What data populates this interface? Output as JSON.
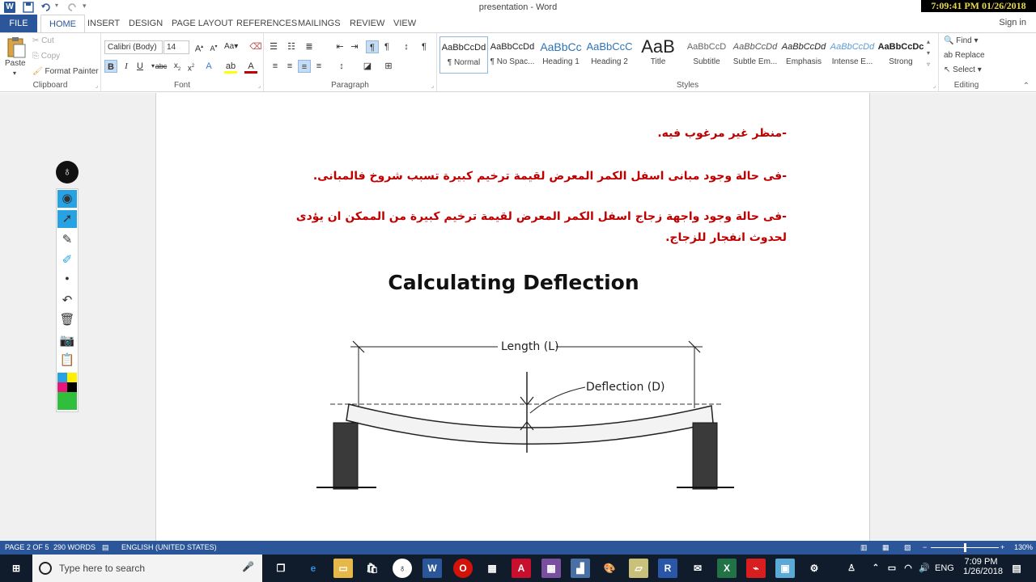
{
  "title_bar": {
    "title": "presentation - Word",
    "clock": "7:09:41 PM 01/26/2018",
    "word_logo": "W"
  },
  "tabs": [
    "FILE",
    "HOME",
    "INSERT",
    "DESIGN",
    "PAGE LAYOUT",
    "REFERENCES",
    "MAILINGS",
    "REVIEW",
    "VIEW"
  ],
  "active_tab": "HOME",
  "sign_in": "Sign in",
  "clipboard": {
    "paste": "Paste",
    "cut": "Cut",
    "copy": "Copy",
    "format_painter": "Format Painter",
    "label": "Clipboard"
  },
  "font": {
    "name": "Calibri (Body)",
    "size": "14",
    "label": "Font"
  },
  "paragraph": {
    "label": "Paragraph"
  },
  "styles": {
    "items": [
      {
        "preview": "AaBbCcDd",
        "name": "¶ Normal"
      },
      {
        "preview": "AaBbCcDd",
        "name": "¶ No Spac..."
      },
      {
        "preview": "AaBbCc",
        "name": "Heading 1"
      },
      {
        "preview": "AaBbCcC",
        "name": "Heading 2"
      },
      {
        "preview": "AaB",
        "name": "Title"
      },
      {
        "preview": "AaBbCcD",
        "name": "Subtitle"
      },
      {
        "preview": "AaBbCcDd",
        "name": "Subtle Em..."
      },
      {
        "preview": "AaBbCcDd",
        "name": "Emphasis"
      },
      {
        "preview": "AaBbCcDd",
        "name": "Intense E..."
      },
      {
        "preview": "AaBbCcDc",
        "name": "Strong"
      }
    ],
    "label": "Styles"
  },
  "editing": {
    "find": "Find",
    "replace": "Replace",
    "select": "Select",
    "label": "Editing"
  },
  "document": {
    "lines": [
      "-منظر غير مرغوب فيه.",
      "-فى حالة وجود مبانى اسفل الكمر المعرض لقيمة ترخيم كبيرة تسبب شروخ فالمبانى.",
      "-فى حالة وجود واجهة زجاج اسفل الكمر المعرض لقيمة ترخيم كبيرة من الممكن ان يؤدى",
      "لحدوث انفجار للزجاج."
    ],
    "figure_title": "Calculating Deflection",
    "length_label": "Length (L)",
    "deflection_label": "Deflection (D)"
  },
  "status": {
    "page": "PAGE 2 OF 5",
    "words": "290 WORDS",
    "language": "ENGLISH (UNITED STATES)",
    "zoom": "130%"
  },
  "taskbar": {
    "search_placeholder": "Type here to search",
    "lang": "ENG",
    "time": "7:09 PM",
    "date": "1/26/2018"
  },
  "colors": {
    "accent": "#2b579a",
    "arabic_text": "#c00000"
  }
}
